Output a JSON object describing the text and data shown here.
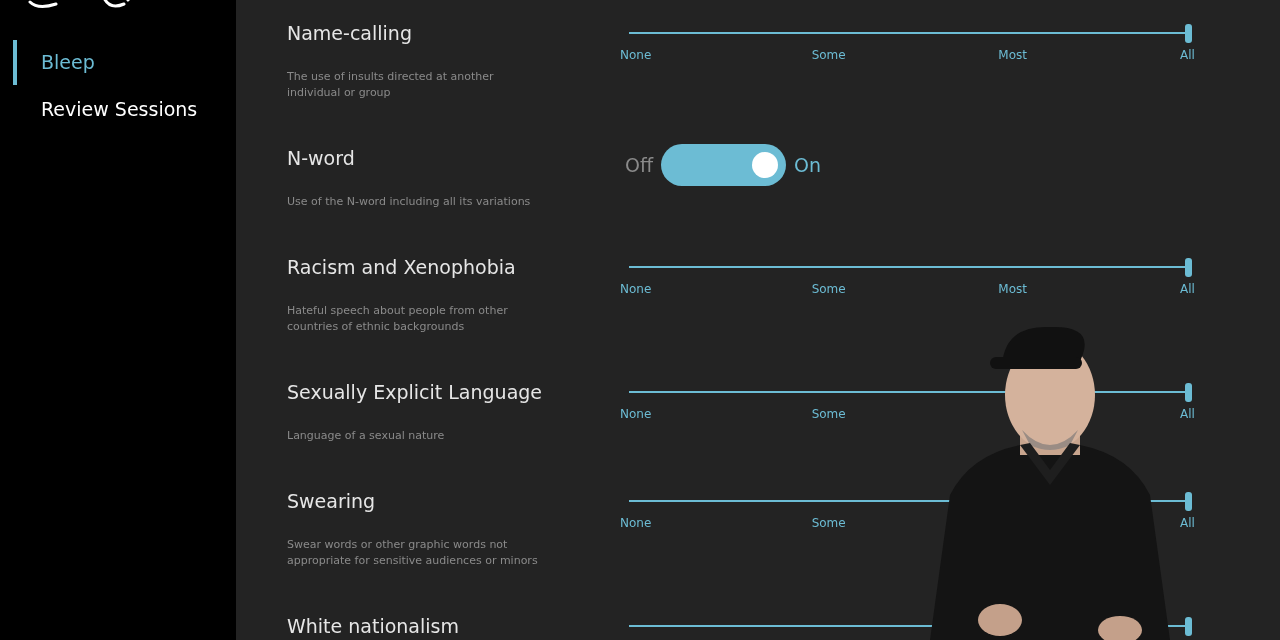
{
  "sidebar": {
    "items": [
      {
        "label": "Bleep",
        "selected": true
      },
      {
        "label": "Review Sessions",
        "selected": false
      }
    ]
  },
  "settings": [
    {
      "kind": "slider",
      "title": "Name-calling",
      "description": "The use of insults directed at another individual or group",
      "level": 1,
      "ticks": [
        {
          "kind": "none",
          "label": "None"
        },
        {
          "kind": "some",
          "label": "Some"
        },
        {
          "kind": "most",
          "label": "Most"
        },
        {
          "kind": "all",
          "label": "All"
        }
      ]
    },
    {
      "kind": "toggle",
      "title": "N-word",
      "description": "Use of the N-word including all its variations",
      "on": true,
      "off_label": "Off",
      "on_label": "On"
    },
    {
      "kind": "slider",
      "title": "Racism and Xenophobia",
      "description": "Hateful speech about people from other countries of ethnic backgrounds",
      "level": 1,
      "ticks": [
        {
          "kind": "none",
          "label": "None"
        },
        {
          "kind": "some",
          "label": "Some"
        },
        {
          "kind": "most",
          "label": "Most"
        },
        {
          "kind": "all",
          "label": "All"
        }
      ]
    },
    {
      "kind": "slider",
      "title": "Sexually Explicit Language",
      "description": "Language of a sexual nature",
      "level": 1,
      "ticks": [
        {
          "kind": "none",
          "label": "None"
        },
        {
          "kind": "some",
          "label": "Some"
        },
        {
          "kind": "all",
          "label": "All"
        }
      ]
    },
    {
      "kind": "slider",
      "title": "Swearing",
      "description": "Swear words or other graphic words not appropriate for sensitive audiences or minors",
      "level": 1,
      "ticks": [
        {
          "kind": "none",
          "label": "None"
        },
        {
          "kind": "some",
          "label": "Some"
        },
        {
          "kind": "all",
          "label": "All"
        }
      ]
    },
    {
      "kind": "slider",
      "title": "White nationalism",
      "level": 1
    }
  ]
}
